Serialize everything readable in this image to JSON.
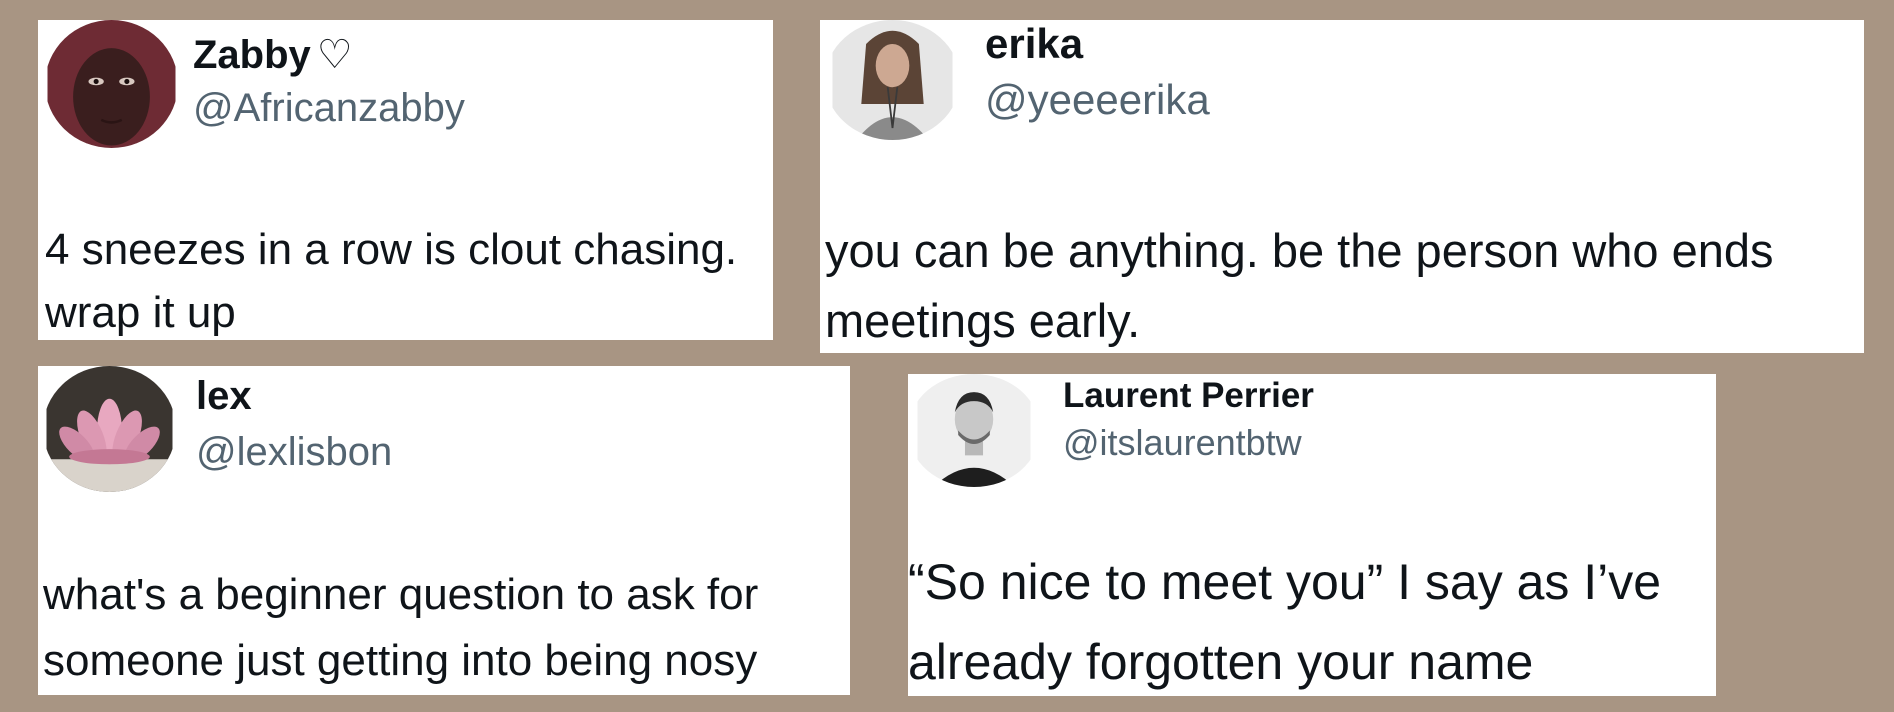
{
  "tweets": [
    {
      "name": "Zabby",
      "name_suffix": "♡",
      "handle": "@Africanzabby",
      "text": "4 sneezes in a row is clout chasing.\nwrap it up"
    },
    {
      "name": "erika",
      "handle": "@yeeeerika",
      "text": "you can be anything. be the person who ends\nmeetings early."
    },
    {
      "name": "lex",
      "handle": "@lexlisbon",
      "text": "what's a beginner question to ask for\nsomeone just getting into being nosy"
    },
    {
      "name": "Laurent Perrier",
      "handle": "@itslaurentbtw",
      "text": "“So nice to meet you” I say as I’ve\nalready forgotten your name"
    }
  ],
  "colors": {
    "background": "#a89583",
    "card": "#ffffff",
    "name": "#0f1419",
    "handle": "#536471"
  },
  "icons": {
    "card_1_avatar": "profile-photo-icon",
    "card_2_avatar": "profile-photo-icon",
    "card_3_avatar": "lotus-icon",
    "card_4_avatar": "profile-photo-icon"
  }
}
